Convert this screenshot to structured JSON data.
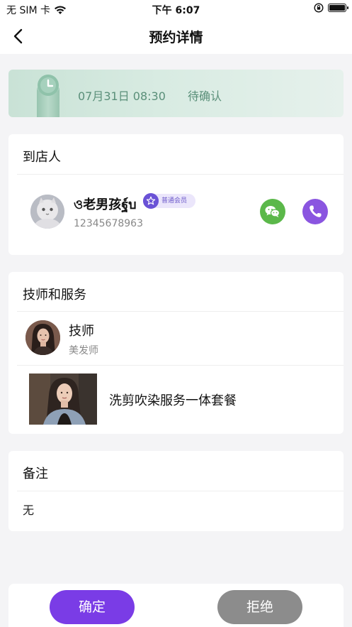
{
  "status_bar": {
    "carrier": "无 SIM 卡",
    "time": "下午 6:07",
    "wifi_icon": "wifi-icon",
    "lock_icon": "orientation-lock-icon",
    "battery_icon": "battery-icon"
  },
  "nav": {
    "title": "预约详情",
    "back_icon": "chevron-left-icon"
  },
  "appointment": {
    "time": "07月31日 08:30",
    "status": "待确认",
    "icon": "clock-icon"
  },
  "customer": {
    "section_title": "到店人",
    "name": "ও老男孩ฐ์บ",
    "member_level": "普通会员",
    "phone": "12345678963",
    "wechat_icon": "wechat-icon",
    "phone_icon": "phone-icon"
  },
  "service": {
    "section_title": "技师和服务",
    "technician_name": "技师",
    "technician_role": "美发师",
    "service_name": "洗剪吹染服务一体套餐"
  },
  "notes": {
    "section_title": "备注",
    "content": "无"
  },
  "actions": {
    "confirm_label": "确定",
    "reject_label": "拒绝"
  },
  "colors": {
    "accent": "#7a3ce6",
    "status_green": "#5a8f79",
    "wechat_green": "#5bb84a",
    "call_purple": "#8a55e0",
    "reject_gray": "#8c8c8c"
  }
}
